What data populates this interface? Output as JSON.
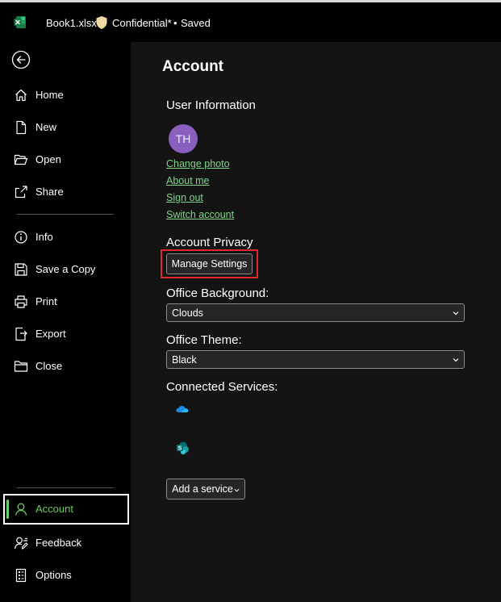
{
  "titlebar": {
    "file_name": "Book1.xlsx",
    "label": "Confidential*",
    "separator": "•",
    "status": "Saved"
  },
  "sidebar": {
    "items": [
      {
        "label": "Home",
        "icon": "home-icon"
      },
      {
        "label": "New",
        "icon": "document-icon"
      },
      {
        "label": "Open",
        "icon": "folder-open-icon"
      },
      {
        "label": "Share",
        "icon": "share-icon"
      },
      {
        "label": "Info",
        "icon": "info-icon"
      },
      {
        "label": "Save a Copy",
        "icon": "save-icon"
      },
      {
        "label": "Print",
        "icon": "printer-icon"
      },
      {
        "label": "Export",
        "icon": "export-icon"
      },
      {
        "label": "Close",
        "icon": "folder-close-icon"
      },
      {
        "label": "Account",
        "icon": "person-icon",
        "active": true
      },
      {
        "label": "Feedback",
        "icon": "feedback-icon"
      },
      {
        "label": "Options",
        "icon": "options-icon"
      }
    ]
  },
  "main": {
    "title": "Account",
    "user_info": {
      "heading": "User Information",
      "initials": "TH",
      "links": [
        "Change photo",
        "About me",
        "Sign out",
        "Switch account"
      ]
    },
    "privacy": {
      "heading": "Account Privacy",
      "button": "Manage Settings"
    },
    "background": {
      "heading": "Office Background:",
      "value": "Clouds"
    },
    "theme": {
      "heading": "Office Theme:",
      "value": "Black"
    },
    "services": {
      "heading": "Connected Services:",
      "items": [
        "onedrive-icon",
        "sharepoint-icon"
      ],
      "add_button": "Add a service"
    }
  },
  "colors": {
    "accent": "#6ccb5f",
    "link": "#7fd488",
    "avatar": "#8a5fc0",
    "focus": "#e0282e"
  }
}
